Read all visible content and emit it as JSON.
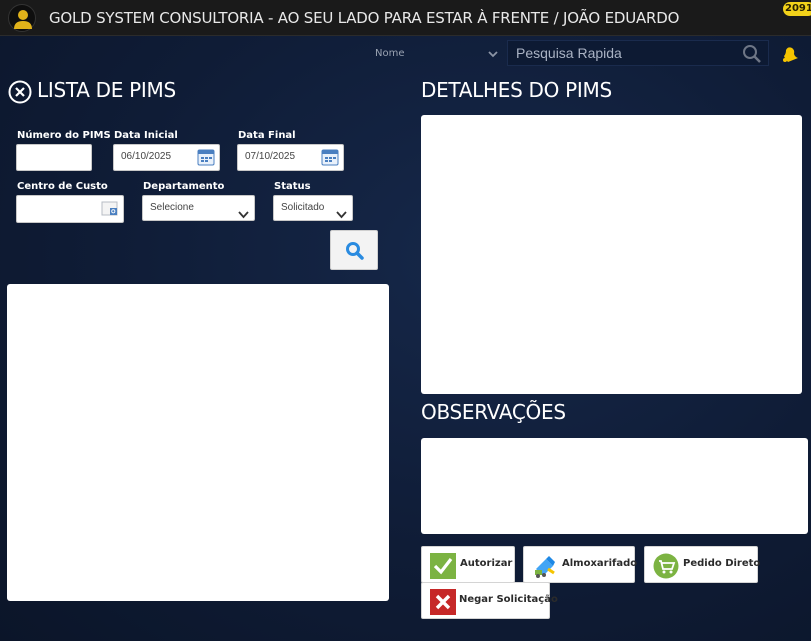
{
  "header": {
    "title": "GOLD SYSTEM CONSULTORIA - AO SEU LADO PARA ESTAR À FRENTE / JOÃO EDUARDO",
    "notification_count": "2091",
    "sort_field_label": "Nome",
    "search_placeholder": "Pesquisa Rapida"
  },
  "list": {
    "title": "LISTA DE PIMS",
    "filters": {
      "numero_label": "Número do PIMS",
      "numero_value": "",
      "data_inicial_label": "Data Inicial",
      "data_inicial_value": "06/10/2025",
      "data_final_label": "Data Final",
      "data_final_value": "07/10/2025",
      "centro_label": "Centro de Custo",
      "centro_value": "",
      "departamento_label": "Departamento",
      "departamento_value": "Selecione",
      "status_label": "Status",
      "status_value": "Solicitado"
    }
  },
  "details": {
    "title": "DETALHES DO PIMS"
  },
  "observations": {
    "title": "OBSERVAÇÕES"
  },
  "actions": {
    "autorizar": "Autorizar",
    "almoxarifado": "Almoxarifado",
    "pedido_direto": "Pedido Direto",
    "negar": "Negar Solicitação"
  },
  "colors": {
    "background": "#0f1c36",
    "topbar": "#1a1a1a",
    "badge": "#f2d21a",
    "accept_green": "#7cb342",
    "deny_red": "#c62828",
    "bell": "#f5c400"
  },
  "icons": [
    "user-avatar-icon",
    "search-icon",
    "bell-icon",
    "close-circle-icon",
    "calendar-icon",
    "chevron-down-icon",
    "check-icon",
    "warehouse-icon",
    "cart-icon",
    "x-icon"
  ]
}
